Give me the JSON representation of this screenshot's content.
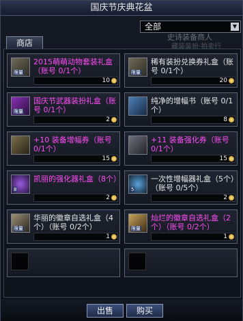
{
  "window": {
    "title": "国庆节庆典花盆"
  },
  "filter": {
    "selected": "全部"
  },
  "background_text": {
    "line1": "史诗装备商人",
    "line2": "藏装装扮·拍卖行"
  },
  "tabs": [
    {
      "label": "商店"
    }
  ],
  "items": [
    {
      "name": "2015萌萌动物套装礼盒（账号 0/1个）",
      "price": "10",
      "tag": "限量",
      "color": "magenta"
    },
    {
      "name": "稀有装扮兑换券礼盒（账号 0/1个）",
      "price": "20",
      "tag": "限量",
      "color": "white"
    },
    {
      "name": "国庆节武器装扮礼盒（账号 0/1个）",
      "price": "2",
      "tag": "限量",
      "color": "magenta"
    },
    {
      "name": "纯净的增幅书（账号 0/1个）",
      "price": "8",
      "tag": "",
      "color": "white"
    },
    {
      "name": "+10 装备增幅券（账号 0/1个）",
      "price": "15",
      "tag": "",
      "color": "magenta"
    },
    {
      "name": "+11 装备强化券（账号 0/1个）",
      "price": "15",
      "tag": "",
      "color": "magenta"
    },
    {
      "name": "凯丽的强化器礼盒（8个）",
      "price": "2",
      "tag": "8",
      "color": "magenta"
    },
    {
      "name": "一次性增幅器礼盒（5个）（账号 0/5个）",
      "price": "2",
      "tag": "5",
      "color": "white"
    },
    {
      "name": "华丽的徽章自选礼盒（4个）（账号 0/2个）",
      "price": "1",
      "tag": "限量",
      "color": "white"
    },
    {
      "name": "灿烂的徽章自选礼盒（2个）（账号 0/2个）",
      "price": "1",
      "tag": "限量",
      "color": "magenta"
    }
  ],
  "buttons": {
    "sell": "出售",
    "buy": "购买"
  }
}
